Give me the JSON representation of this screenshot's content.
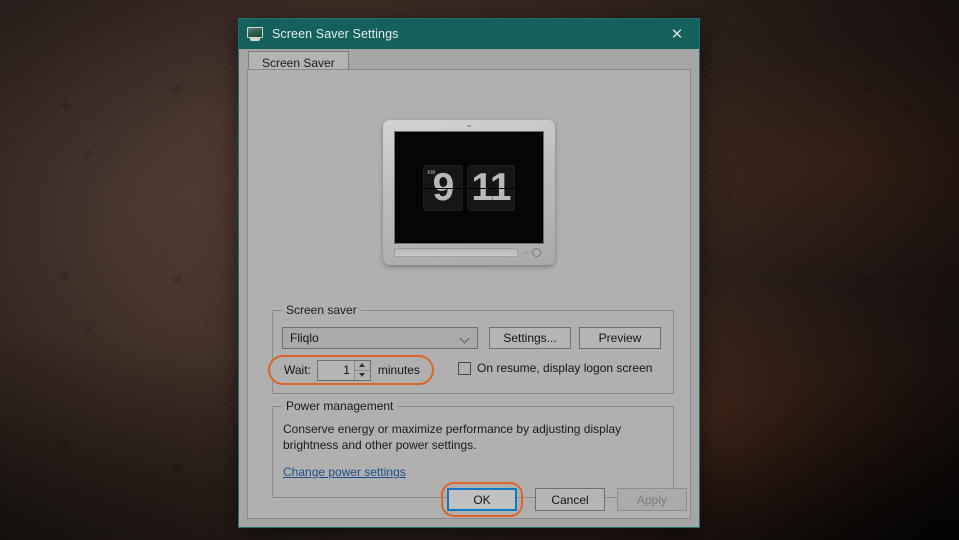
{
  "desktop": {
    "name": "desktop-wallpaper"
  },
  "window": {
    "title": "Screen Saver Settings",
    "icon": "monitor-icon",
    "close_label": "✕",
    "titlebar_color": "#14605c"
  },
  "tabs": [
    {
      "label": "Screen Saver",
      "selected": true
    }
  ],
  "preview": {
    "screensaver_name": "Fliqlo",
    "clock": {
      "hours": "9",
      "minutes": "11",
      "meridiem": "AM"
    }
  },
  "screen_saver_group": {
    "legend": "Screen saver",
    "combo": {
      "value": "Fliqlo",
      "chevron": "chevron-down-icon"
    },
    "settings_button": "Settings...",
    "preview_button": "Preview",
    "wait": {
      "label": "Wait:",
      "value": "1",
      "units": "minutes",
      "highlighted": true,
      "highlight_color": "#dd6528"
    },
    "logon_checkbox": {
      "label": "On resume, display logon screen",
      "checked": false
    }
  },
  "power_group": {
    "legend": "Power management",
    "description": "Conserve energy or maximize performance by adjusting display brightness and other power settings.",
    "link": "Change power settings",
    "link_color": "#1b4f8a"
  },
  "footer": {
    "ok": "OK",
    "cancel": "Cancel",
    "apply": "Apply",
    "apply_disabled": true,
    "ok_focused": true,
    "ok_highlight_color": "#dd6528",
    "focus_color": "#1177c4"
  }
}
